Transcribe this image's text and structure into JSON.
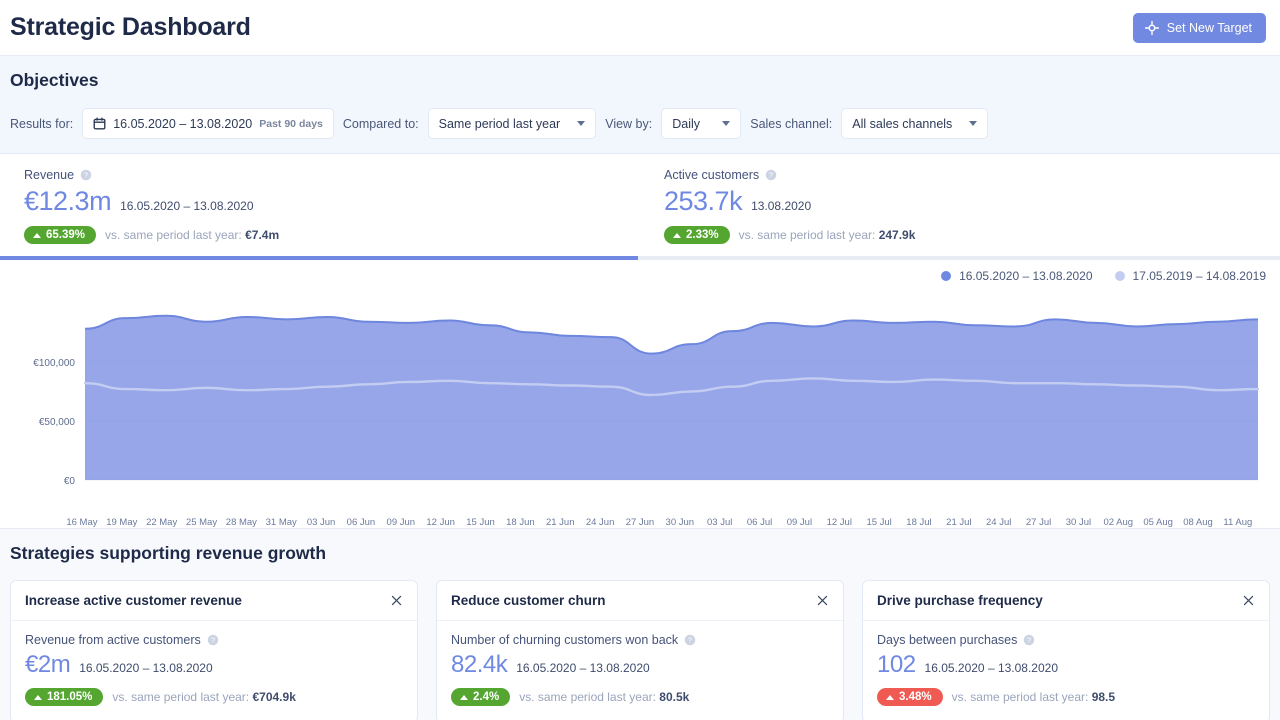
{
  "header": {
    "title": "Strategic Dashboard",
    "action_button": {
      "label": "Set New Target",
      "icon": "target-icon"
    }
  },
  "objectives": {
    "section_title": "Objectives",
    "filters": {
      "results_for_label": "Results for:",
      "date_range": "16.05.2020 – 13.08.2020",
      "date_range_note": "Past 90 days",
      "compared_to_label": "Compared to:",
      "compared_to_value": "Same period last year",
      "view_by_label": "View by:",
      "view_by_value": "Daily",
      "sales_channel_label": "Sales channel:",
      "sales_channel_value": "All sales channels"
    }
  },
  "kpis": [
    {
      "name": "Revenue",
      "value": "€12.3m",
      "range": "16.05.2020 – 13.08.2020",
      "delta": "65.39%",
      "direction": "up",
      "comparison_prefix": "vs. same period last year:",
      "comparison_value": "€7.4m",
      "active": true
    },
    {
      "name": "Active customers",
      "value": "253.7k",
      "range": "13.08.2020",
      "delta": "2.33%",
      "direction": "up",
      "comparison_prefix": "vs. same period last year:",
      "comparison_value": "247.9k",
      "active": false
    }
  ],
  "legend": [
    {
      "label": "16.05.2020 – 13.08.2020",
      "color": "#6f88e2"
    },
    {
      "label": "17.05.2019 – 14.08.2019",
      "color": "#c3cdf2"
    }
  ],
  "chart_data": {
    "type": "area",
    "title": "",
    "xlabel": "",
    "ylabel": "",
    "ylim": [
      0,
      160000
    ],
    "grid": true,
    "legend_position": "top-right",
    "ytick_labels": [
      "€0",
      "€50,000",
      "€100,000"
    ],
    "ytick_values": [
      0,
      50000,
      100000
    ],
    "categories": [
      "16 May",
      "19 May",
      "22 May",
      "25 May",
      "28 May",
      "31 May",
      "03 Jun",
      "06 Jun",
      "09 Jun",
      "12 Jun",
      "15 Jun",
      "18 Jun",
      "21 Jun",
      "24 Jun",
      "27 Jun",
      "30 Jun",
      "03 Jul",
      "06 Jul",
      "09 Jul",
      "12 Jul",
      "15 Jul",
      "18 Jul",
      "21 Jul",
      "24 Jul",
      "27 Jul",
      "30 Jul",
      "02 Aug",
      "05 Aug",
      "08 Aug",
      "11 Aug"
    ],
    "series": [
      {
        "name": "16.05.2020 – 13.08.2020",
        "color": "#7f93e3",
        "fill": true,
        "values": [
          128000,
          137000,
          139000,
          134000,
          138000,
          136000,
          138000,
          134000,
          133000,
          135000,
          131000,
          125000,
          122000,
          121000,
          107000,
          115000,
          126000,
          133000,
          130000,
          135000,
          133000,
          134000,
          131000,
          130000,
          136000,
          133000,
          130000,
          132000,
          134000,
          136000
        ]
      },
      {
        "name": "17.05.2019 – 14.08.2019",
        "color": "#c3cdf2",
        "fill": false,
        "values": [
          82000,
          77000,
          76000,
          78000,
          76000,
          77000,
          79000,
          81000,
          83000,
          84000,
          82000,
          81000,
          80000,
          79000,
          72000,
          75000,
          79000,
          84000,
          86000,
          84000,
          83000,
          85000,
          84000,
          82000,
          82000,
          81000,
          80000,
          79000,
          76000,
          77000
        ]
      }
    ]
  },
  "strategies": {
    "title": "Strategies supporting revenue growth",
    "cards": [
      {
        "title": "Increase active customer revenue",
        "metric_name": "Revenue from active customers",
        "value": "€2m",
        "range": "16.05.2020 – 13.08.2020",
        "delta": "181.05%",
        "direction": "up",
        "comparison_prefix": "vs. same period last year:",
        "comparison_value": "€704.9k"
      },
      {
        "title": "Reduce customer churn",
        "metric_name": "Number of churning customers won back",
        "value": "82.4k",
        "range": "16.05.2020 – 13.08.2020",
        "delta": "2.4%",
        "direction": "up",
        "comparison_prefix": "vs. same period last year:",
        "comparison_value": "80.5k"
      },
      {
        "title": "Drive purchase frequency",
        "metric_name": "Days between purchases",
        "value": "102",
        "range": "16.05.2020 – 13.08.2020",
        "delta": "3.48%",
        "direction": "down",
        "comparison_prefix": "vs. same period last year:",
        "comparison_value": "98.5"
      }
    ]
  }
}
